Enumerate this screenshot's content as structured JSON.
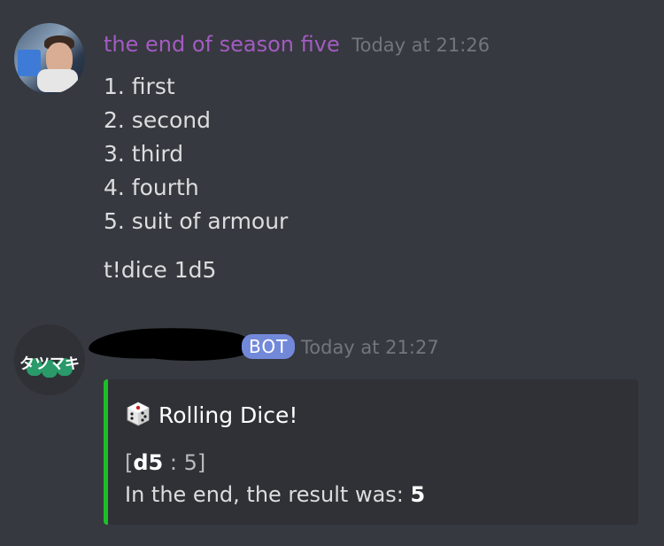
{
  "messages": [
    {
      "author": "the end of season five",
      "timestamp": "Today at 21:26",
      "lines": [
        "1. first",
        "2. second",
        "3. third",
        "4. fourth",
        "5. suit of armour",
        "t!dice 1d5"
      ]
    },
    {
      "avatar_text": "タツマキ",
      "badge": "BOT",
      "timestamp": "Today at 21:27",
      "embed": {
        "title": "Rolling Dice!",
        "roll_open": "[",
        "roll_die": "d5",
        "roll_sep": " : ",
        "roll_value": "5",
        "roll_close": "]",
        "result_prefix": "In the end, the result was: ",
        "result_value": "5",
        "accent_color": "#1cbf28"
      }
    }
  ],
  "colors": {
    "background": "#36393f",
    "author_name": "#a35bc2",
    "bot_badge": "#7289da",
    "embed_background": "#2f3136"
  },
  "icons": {
    "die": "game-die-icon"
  }
}
